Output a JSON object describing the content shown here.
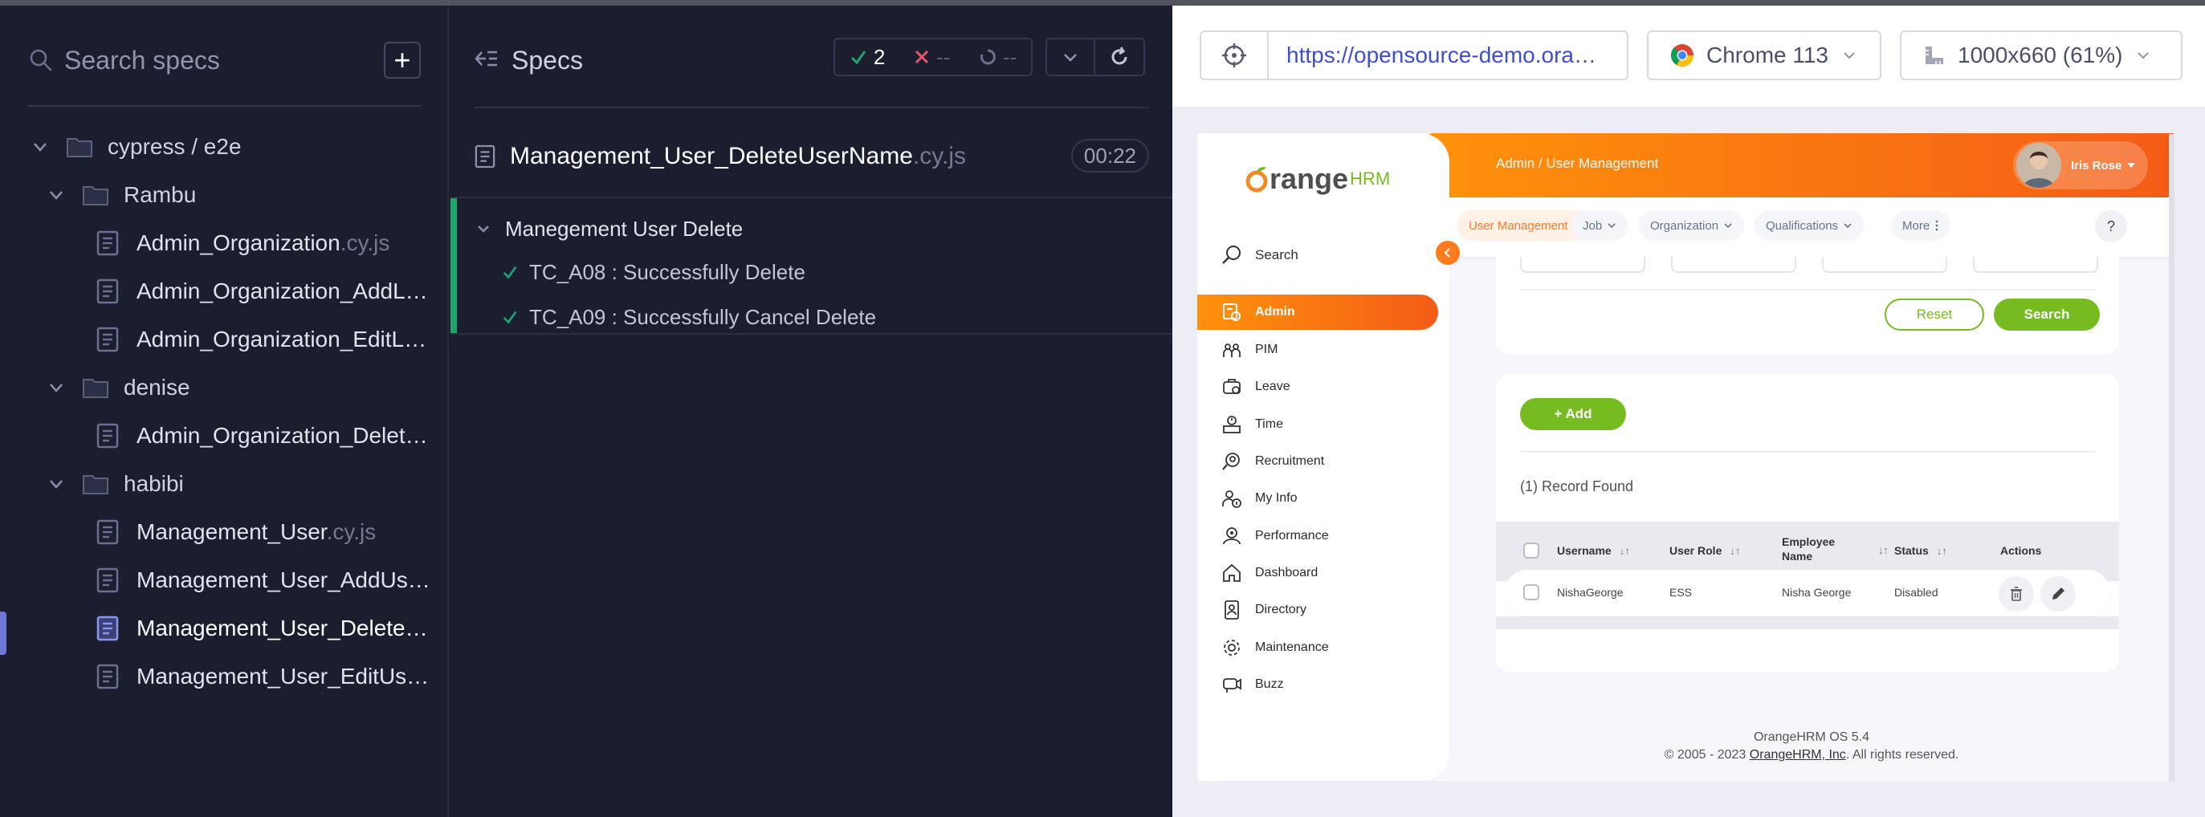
{
  "spec_list": {
    "search_placeholder": "Search specs",
    "add_label": "+",
    "tree": {
      "root": "cypress / e2e",
      "folders": [
        {
          "name": "Rambu",
          "files": [
            {
              "base": "Admin_Organization",
              "ext": ".cy.js"
            },
            {
              "base": "Admin_Organization_AddL…",
              "ext": ""
            },
            {
              "base": "Admin_Organization_EditL…",
              "ext": ""
            }
          ]
        },
        {
          "name": "denise",
          "files": [
            {
              "base": "Admin_Organization_Delet…",
              "ext": ""
            }
          ]
        },
        {
          "name": "habibi",
          "files": [
            {
              "base": "Management_User",
              "ext": ".cy.js"
            },
            {
              "base": "Management_User_AddUs…",
              "ext": ""
            },
            {
              "base": "Management_User_Delete…",
              "ext": ""
            },
            {
              "base": "Management_User_EditUs…",
              "ext": ""
            }
          ]
        }
      ]
    },
    "active_color": "#6f77d6"
  },
  "reporter": {
    "title": "Specs",
    "stats": {
      "passed": "2",
      "failed": "--",
      "pending": "--"
    },
    "spec_name": "Management_User_DeleteUserName",
    "spec_ext": ".cy.js",
    "duration": "00:22",
    "suite": "Manegement User Delete",
    "tests": [
      {
        "title": "TC_A08 : Successfully Delete",
        "state": "passed"
      },
      {
        "title": "TC_A09 : Successfully Cancel Delete",
        "state": "passed"
      }
    ],
    "pass_color": "#1ea56b",
    "fail_color": "#e45770"
  },
  "aut_bar": {
    "url": "https://opensource-demo.ora…",
    "browser": "Chrome 113",
    "viewport": "1000x660 (61%)"
  },
  "app": {
    "logo_text": "range",
    "logo_brand": "HRM",
    "breadcrumb": "Admin / User Management",
    "user_name": "Iris Rose",
    "search_label": "Search",
    "nav": [
      {
        "label": "Admin",
        "icon": "admin-icon"
      },
      {
        "label": "PIM",
        "icon": "pim-icon"
      },
      {
        "label": "Leave",
        "icon": "leave-icon"
      },
      {
        "label": "Time",
        "icon": "time-icon"
      },
      {
        "label": "Recruitment",
        "icon": "recruitment-icon"
      },
      {
        "label": "My Info",
        "icon": "my-info-icon"
      },
      {
        "label": "Performance",
        "icon": "performance-icon"
      },
      {
        "label": "Dashboard",
        "icon": "dashboard-icon"
      },
      {
        "label": "Directory",
        "icon": "directory-icon"
      },
      {
        "label": "Maintenance",
        "icon": "maintenance-icon"
      },
      {
        "label": "Buzz",
        "icon": "buzz-icon"
      }
    ],
    "tabs": [
      "User Management",
      "Job",
      "Organization",
      "Qualifications",
      "More"
    ],
    "reset_label": "Reset",
    "search_button": "Search",
    "add_label": "+ Add",
    "records_found": "(1) Record Found",
    "columns": [
      "Username",
      "User Role",
      "Employee Name",
      "Status",
      "Actions"
    ],
    "rows": [
      {
        "username": "NishaGeorge",
        "role": "ESS",
        "employee": "Nisha George",
        "status": "Disabled"
      }
    ],
    "footer_version": "OrangeHRM OS 5.4",
    "footer_copy_prefix": "© 2005 - 2023",
    "footer_link": "OrangeHRM, Inc",
    "footer_copy_suffix": ". All rights reserved.",
    "brand_orange": "#ff7b1d",
    "brand_green": "#76bc21"
  }
}
